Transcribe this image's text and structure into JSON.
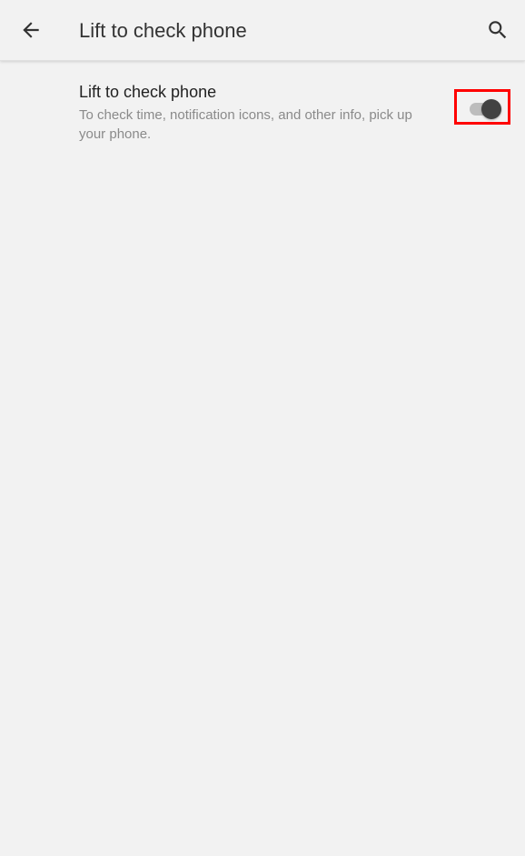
{
  "app_bar": {
    "title": "Lift to check phone",
    "back_icon": "arrow-left-icon",
    "search_icon": "search-icon"
  },
  "setting": {
    "title": "Lift to check phone",
    "summary": "To check time, notification icons, and other info, pick up your phone.",
    "toggle_on": true
  },
  "colors": {
    "background": "#f2f2f2",
    "highlight_box": "#ff0000",
    "toggle_thumb": "#424242",
    "toggle_track": "#bdbdbd"
  }
}
